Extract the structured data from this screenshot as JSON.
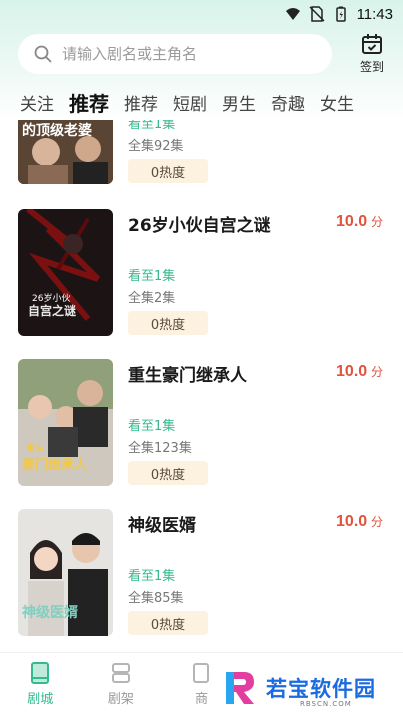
{
  "status": {
    "time": "11:43"
  },
  "search": {
    "placeholder": "请输入剧名或主角名"
  },
  "checkin": {
    "label": "签到"
  },
  "tabs": [
    "关注",
    "推荐",
    "推荐",
    "短剧",
    "男生",
    "奇趣",
    "女生"
  ],
  "items": [
    {
      "title": "",
      "score": "",
      "unit": "",
      "watched": "看至1集",
      "episodes": "全集92集",
      "heat": "0热度",
      "cover_text": "的顶级老婆"
    },
    {
      "title": "26岁小伙自宫之谜",
      "score": "10.0",
      "unit": "分",
      "watched": "看至1集",
      "episodes": "全集2集",
      "heat": "0热度",
      "cover_text": "26岁小伙 自宫之谜"
    },
    {
      "title": "重生豪门继承人",
      "score": "10.0",
      "unit": "分",
      "watched": "看至1集",
      "episodes": "全集123集",
      "heat": "0热度",
      "cover_text": "重生 豪门继承人"
    },
    {
      "title": "神级医婿",
      "score": "10.0",
      "unit": "分",
      "watched": "看至1集",
      "episodes": "全集85集",
      "heat": "0热度",
      "cover_text": "神级医婿"
    }
  ],
  "nav": [
    {
      "label": "剧城",
      "icon": "book-icon",
      "active": true
    },
    {
      "label": "剧架",
      "icon": "shelf-icon",
      "active": false
    },
    {
      "label": "商",
      "icon": "store-icon",
      "active": false
    }
  ],
  "watermark": {
    "text": "若宝软件园",
    "sub": "RBSCN.COM"
  },
  "colors": {
    "accent": "#35b98f",
    "score": "#e0533f",
    "heat_bg": "#fdf1df"
  }
}
